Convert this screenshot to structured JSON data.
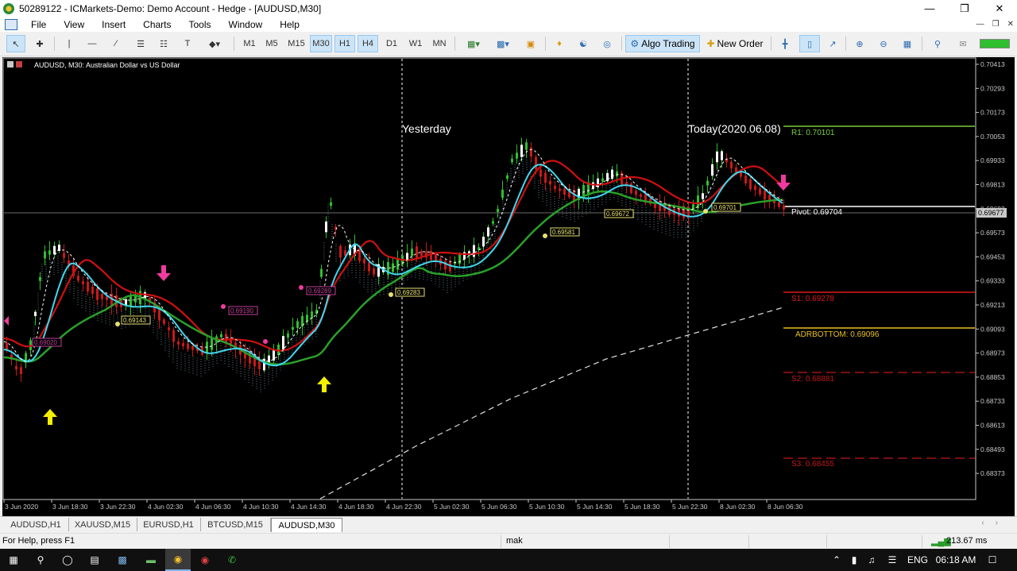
{
  "window": {
    "title": "50289122 - ICMarkets-Demo: Demo Account - Hedge - [AUDUSD,M30]"
  },
  "menu": [
    "File",
    "View",
    "Insert",
    "Charts",
    "Tools",
    "Window",
    "Help"
  ],
  "toolbar": {
    "timeframes": [
      "M1",
      "M5",
      "M15",
      "M30",
      "H1",
      "H4",
      "D1",
      "W1",
      "MN"
    ],
    "active_timeframes": [
      "M30",
      "H1",
      "H4"
    ],
    "algo_trading": "Algo Trading",
    "new_order": "New Order"
  },
  "chart": {
    "symbol_label": "AUDUSD, M30:  Australian Dollar vs US Dollar",
    "price_scale": [
      "0.70413",
      "0.70293",
      "0.70173",
      "0.70053",
      "0.69933",
      "0.69813",
      "0.69693",
      "0.69573",
      "0.69453",
      "0.69333",
      "0.69213",
      "0.69093",
      "0.68973",
      "0.68853",
      "0.68733",
      "0.68613",
      "0.68493",
      "0.68373"
    ],
    "current_price": "0.69677",
    "time_labels": [
      "3 Jun 2020",
      "3 Jun 18:30",
      "3 Jun 22:30",
      "4 Jun 02:30",
      "4 Jun 06:30",
      "4 Jun 10:30",
      "4 Jun 14:30",
      "4 Jun 18:30",
      "4 Jun 22:30",
      "5 Jun 02:30",
      "5 Jun 06:30",
      "5 Jun 10:30",
      "5 Jun 14:30",
      "5 Jun 18:30",
      "5 Jun 22:30",
      "8 Jun 02:30",
      "8 Jun 06:30"
    ],
    "session_labels": {
      "yesterday": "Yesterday",
      "today": "Today(2020.06.08)"
    },
    "levels": [
      {
        "label": "R1: 0.70101",
        "color": "#7ccd3a"
      },
      {
        "label": "Pivot: 0.69704",
        "color": "#ffffff"
      },
      {
        "label": "S1: 0.69278",
        "color": "#e01818"
      },
      {
        "label": "ADRBOTTOM: 0.69096",
        "color": "#e8c020"
      },
      {
        "label": "S2: 0.68881",
        "color": "#c01818"
      },
      {
        "label": "S3: 0.68455",
        "color": "#c01818"
      }
    ],
    "price_tags": [
      "0.69020",
      "0.69143",
      "0.69190",
      "0.69289",
      "0.69283",
      "0.69581",
      "0.69672",
      "0.69701"
    ]
  },
  "tabs": [
    "AUDUSD,H1",
    "XAUUSD,M15",
    "EURUSD,H1",
    "BTCUSD,M15",
    "AUDUSD,M30"
  ],
  "active_tab": "AUDUSD,M30",
  "status": {
    "help": "For Help, press F1",
    "profile": "mak",
    "ping": "213.67 ms"
  },
  "taskbar": {
    "lang": "ENG",
    "time": "06:18 AM"
  }
}
